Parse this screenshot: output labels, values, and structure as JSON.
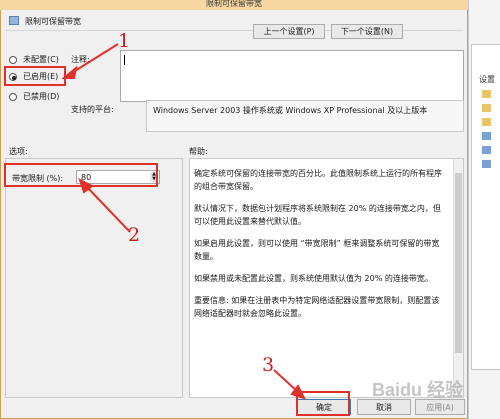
{
  "window": {
    "title": "限制可保留带宽"
  },
  "header": {
    "policy_name": "限制可保留带宽",
    "prev_button": "上一个设置(P)",
    "next_button": "下一个设置(N)"
  },
  "state": {
    "options": [
      {
        "label": "未配置(C)",
        "selected": false
      },
      {
        "label": "已启用(E)",
        "selected": true
      },
      {
        "label": "已禁用(D)",
        "selected": false
      }
    ]
  },
  "comment": {
    "label": "注释:",
    "value": ""
  },
  "platform": {
    "label": "支持的平台:",
    "value": "Windows Server 2003 操作系统或 Windows XP Professional 及以上版本"
  },
  "options_panel": {
    "title": "选项:",
    "bandwidth_label": "带宽限制 (%):",
    "bandwidth_value": "80"
  },
  "help_panel": {
    "title": "帮助:",
    "paragraphs": [
      "确定系统可保留的连接带宽的百分比。此值限制系统上运行的所有程序的组合带宽保留。",
      "默认情况下，数据包计划程序将系统限制在 20% 的连接带宽之内，但可以使用此设置来替代默认值。",
      "如果启用此设置，则可以使用 “带宽限制” 框来调整系统可保留的带宽数量。",
      "如果禁用或未配置此设置，则系统使用默认值为 20% 的连接带宽。",
      "重要信息: 如果在注册表中为特定网络适配器设置带宽限制，则配置该网络适配器时就会忽略此设置。"
    ]
  },
  "footer": {
    "ok_button": "确定",
    "cancel_button": "取消",
    "apply_button": "应用(A)"
  },
  "background_window": {
    "label": "设置"
  },
  "annotations": [
    "1",
    "2",
    "3"
  ],
  "watermark": "Baidu 经验",
  "colors": {
    "annotation_red": "#e0302a",
    "title_bar": "#f6d7a2",
    "dialog_bg": "#f0f0f0"
  }
}
